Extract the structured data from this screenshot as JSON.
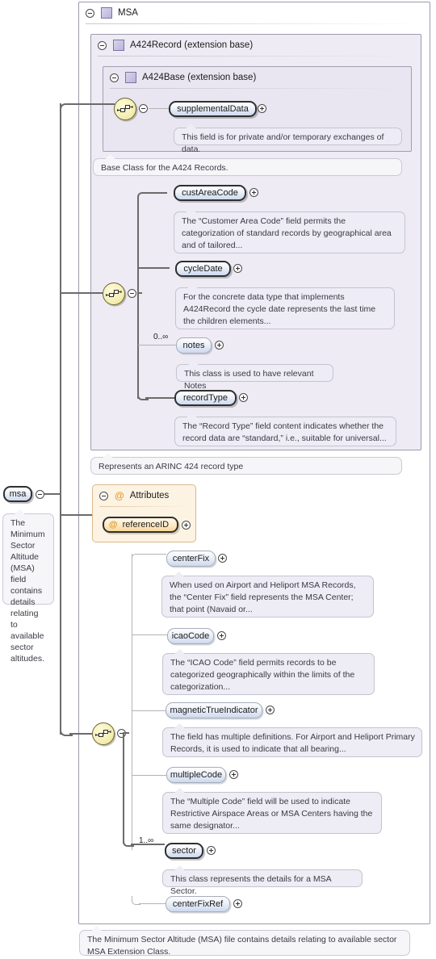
{
  "diagram": {
    "title": "MSA",
    "type": "xml-schema-element-diagram"
  },
  "root_element": {
    "label": "msa",
    "annotation": "The Minimum Sector Altitude (MSA) field contains details relating to available sector altitudes."
  },
  "containers": [
    {
      "id": "msa",
      "title": "MSA",
      "glyph": "complex-type-square"
    },
    {
      "id": "a424record",
      "title": "A424Record (extension base)",
      "glyph": "complex-type-square"
    },
    {
      "id": "a424base",
      "title": "A424Base (extension base)",
      "glyph": "complex-type-square"
    },
    {
      "id": "attributes",
      "title": "Attributes",
      "glyph": "at-sign"
    }
  ],
  "nodes": {
    "supplementalData": {
      "label": "supplementalData",
      "required": true,
      "annotation": "This field is for private and/or temporary exchanges of data."
    },
    "custAreaCode": {
      "label": "custAreaCode",
      "required": true,
      "annotation": "The “Customer Area Code” field permits the categorization of standard records by geographical area and of tailored..."
    },
    "cycleDate": {
      "label": "cycleDate",
      "required": true,
      "annotation": "For the concrete data type that implements A424Record the cycle date represents the last time the children elements..."
    },
    "notes": {
      "label": "notes",
      "required": false,
      "cardinality": "0..∞",
      "annotation": "This class is used to have relevant Notes"
    },
    "recordType": {
      "label": "recordType",
      "required": true,
      "annotation": "The “Record Type” field content indicates whether the record data are “standard,” i.e., suitable for universal..."
    },
    "referenceID": {
      "label": "referenceID",
      "required": true,
      "kind": "attribute"
    },
    "centerFix": {
      "label": "centerFix",
      "required": false,
      "annotation": "When used on Airport and Heliport MSA Records, the “Center Fix” field represents the MSA Center; that point (Navaid or..."
    },
    "icaoCode": {
      "label": "icaoCode",
      "required": false,
      "annotation": "The “ICAO Code” field permits records to be categorized geographically within the limits of the categorization..."
    },
    "magneticTrueIndicator": {
      "label": "magneticTrueIndicator",
      "required": false,
      "annotation": "The field has multiple definitions. For Airport and Heliport Primary Records, it is used to indicate that all bearing..."
    },
    "multipleCode": {
      "label": "multipleCode",
      "required": false,
      "annotation": "The “Multiple Code” field will be used to indicate Restrictive Airspace Areas or MSA Centers having the same designator..."
    },
    "sector": {
      "label": "sector",
      "required": true,
      "cardinality": "1..∞",
      "annotation": "This class represents the details for a MSA Sector."
    },
    "centerFixRef": {
      "label": "centerFixRef",
      "required": false
    }
  },
  "container_annotations": {
    "a424base": "Base Class for the A424 Records.",
    "a424record": "Represents an ARINC 424 record type",
    "msa": "The Minimum Sector Altitude (MSA) file contains details relating to available sector MSA Extension Class."
  },
  "colors": {
    "container_fill": "#eeebf4",
    "container_border": "#9e9bb0",
    "node_fill": "#ccd9ee",
    "attribute_fill": "#f8d79a",
    "sequence_icon": "#f5efb4",
    "annotation_fill": "#eeecf4",
    "line": "#6b6b6b"
  }
}
